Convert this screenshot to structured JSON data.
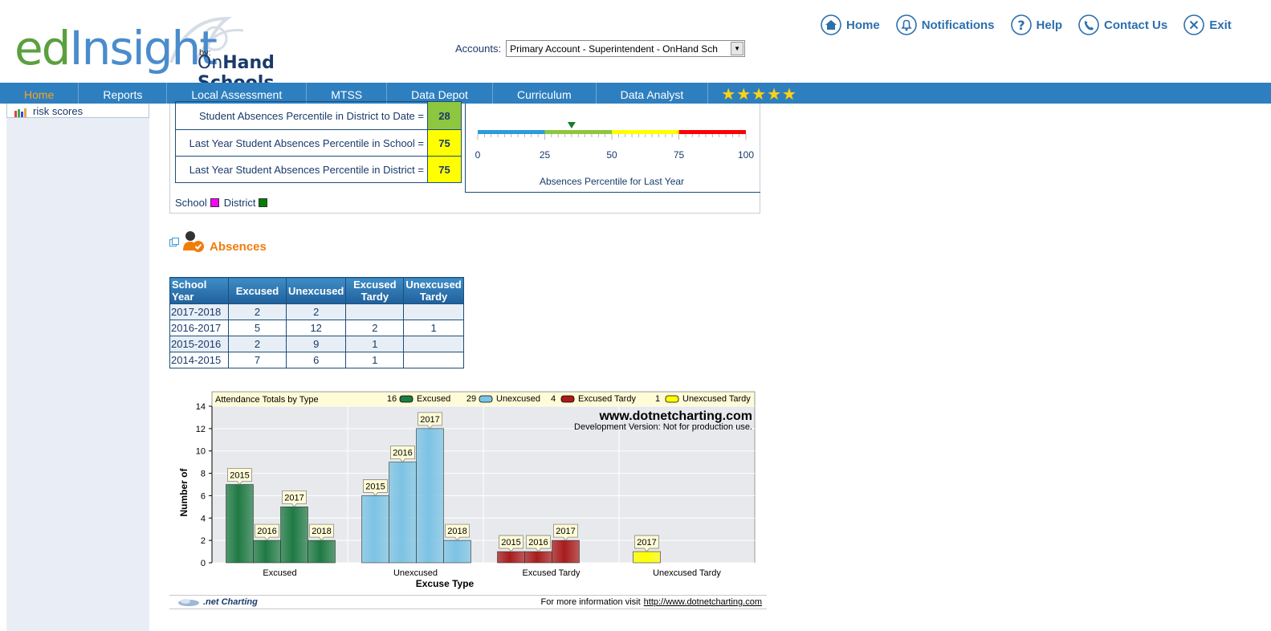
{
  "header": {
    "logo_ed": "ed",
    "logo_insight": "Insight",
    "logo_by": "by:",
    "logo_onhand_on": "On",
    "logo_onhand_rest": "Hand Schools",
    "accounts_label": "Accounts:",
    "accounts_value": "Primary Account - Superintendent - OnHand Sch"
  },
  "topnav": {
    "home": "Home",
    "notifications": "Notifications",
    "help": "Help",
    "contact": "Contact Us",
    "exit": "Exit"
  },
  "menu": {
    "home": "Home",
    "reports": "Reports",
    "local_assessment": "Local Assessment",
    "mtss": "MTSS",
    "data_depot": "Data Depot",
    "curriculum": "Curriculum",
    "data_analyst": "Data Analyst",
    "stars": 5
  },
  "sidebar": {
    "item": "risk scores"
  },
  "percentiles": {
    "rows": [
      {
        "label": "Student Absences Percentile in District to Date =",
        "value": "28",
        "color": "#8dc63f"
      },
      {
        "label": "Last Year Student Absences Percentile in School =",
        "value": "75",
        "color": "#ffff00"
      },
      {
        "label": "Last Year Student Absences Percentile in District =",
        "value": "75",
        "color": "#ffff00"
      }
    ],
    "gauge": {
      "ticks": [
        "0",
        "25",
        "50",
        "75",
        "100"
      ],
      "marker_value": 35,
      "caption": "Absences Percentile for Last Year",
      "segment_colors": [
        "#2d9ae0",
        "#8dc63f",
        "#ffff00",
        "#ff0000"
      ]
    },
    "legend": {
      "school": "School",
      "district": "District",
      "school_color": "#ff00ff",
      "district_color": "#008000"
    }
  },
  "absences": {
    "title": "Absences",
    "columns": [
      "School Year",
      "Excused",
      "Unexcused",
      "Excused Tardy",
      "Unexcused Tardy"
    ],
    "rows": [
      [
        "2017-2018",
        "2",
        "2",
        "",
        ""
      ],
      [
        "2016-2017",
        "5",
        "12",
        "2",
        "1"
      ],
      [
        "2015-2016",
        "2",
        "9",
        "1",
        ""
      ],
      [
        "2014-2015",
        "7",
        "6",
        "1",
        ""
      ]
    ]
  },
  "chart_data": {
    "type": "bar",
    "title": "Attendance Totals by Type",
    "xlabel": "Excuse Type",
    "ylabel": "Number of",
    "ylim": [
      0,
      14
    ],
    "yticks": [
      0,
      2,
      4,
      6,
      8,
      10,
      12,
      14
    ],
    "grid": true,
    "categories": [
      "Excused",
      "Unexcused",
      "Excused Tardy",
      "Unexcused Tardy"
    ],
    "legend": [
      {
        "total": "16",
        "name": "Excused",
        "color": "#1f7a43"
      },
      {
        "total": "29",
        "name": "Unexcused",
        "color": "#7cc3e4"
      },
      {
        "total": "4",
        "name": "Excused Tardy",
        "color": "#a81c1c"
      },
      {
        "total": "1",
        "name": "Unexcused Tardy",
        "color": "#ffff00"
      }
    ],
    "groups": [
      {
        "category": "Excused",
        "color": "#1f7a43",
        "bars": [
          {
            "year": "2015",
            "value": 7
          },
          {
            "year": "2016",
            "value": 2
          },
          {
            "year": "2017",
            "value": 5
          },
          {
            "year": "2018",
            "value": 2
          }
        ]
      },
      {
        "category": "Unexcused",
        "color": "#7cc3e4",
        "bars": [
          {
            "year": "2015",
            "value": 6
          },
          {
            "year": "2016",
            "value": 9
          },
          {
            "year": "2017",
            "value": 12
          },
          {
            "year": "2018",
            "value": 2
          }
        ]
      },
      {
        "category": "Excused Tardy",
        "color": "#a81c1c",
        "bars": [
          {
            "year": "2015",
            "value": 1
          },
          {
            "year": "2016",
            "value": 1
          },
          {
            "year": "2017",
            "value": 2
          }
        ]
      },
      {
        "category": "Unexcused Tardy",
        "color": "#ffff00",
        "bars": [
          {
            "year": "2017",
            "value": 1
          }
        ]
      }
    ],
    "watermark_title": "www.dotnetcharting.com",
    "watermark_sub": "Development Version: Not for production use."
  },
  "footer": {
    "logo_text": ".net Charting",
    "info": "For more information visit",
    "link": "http://www.dotnetcharting.com"
  }
}
